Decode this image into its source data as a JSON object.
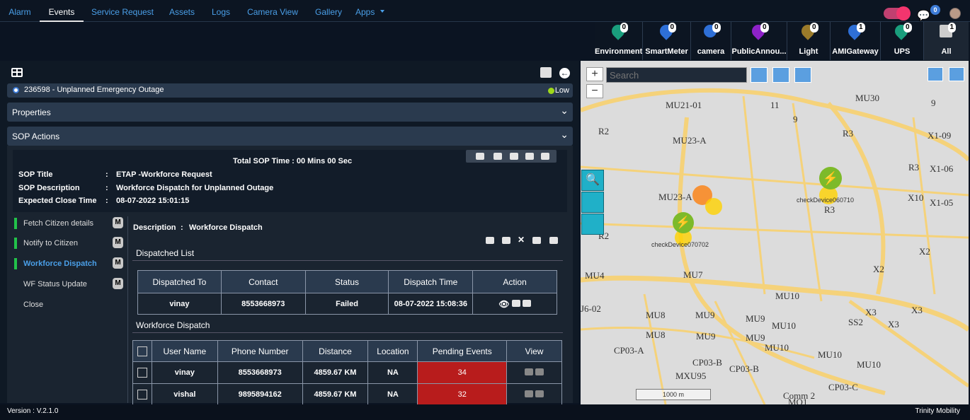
{
  "nav": {
    "tabs": [
      "Alarm",
      "Events",
      "Service Request",
      "Assets",
      "Logs",
      "Camera View",
      "Gallery",
      "Apps"
    ]
  },
  "chat_count": "0",
  "layers": [
    {
      "label": "Environment",
      "count": "0",
      "color": "#1a9e7d"
    },
    {
      "label": "SmartMeter",
      "count": "0",
      "color": "#2e6fd6"
    },
    {
      "label": "camera",
      "count": "0",
      "color": "#2e6fd6"
    },
    {
      "label": "PublicAnnou...",
      "count": "0",
      "color": "#8e22c8"
    },
    {
      "label": "Light",
      "count": "0",
      "color": "#9a7a2a"
    },
    {
      "label": "AMIGateway",
      "count": "1",
      "color": "#2e6fd6"
    },
    {
      "label": "UPS",
      "count": "0",
      "color": "#1a9e7d"
    },
    {
      "label": "All",
      "count": "1",
      "color": "#cccccc"
    }
  ],
  "event": {
    "title": "236598 - Unplanned Emergency Outage",
    "priority": "Low"
  },
  "panels": {
    "properties": "Properties",
    "sop": "SOP Actions"
  },
  "sop": {
    "total_time": "Total SOP Time : 00 Mins 00 Sec",
    "title_label": "SOP Title",
    "title_value": "ETAP -Workforce Request",
    "desc_label": "SOP Description",
    "desc_value": "Workforce Dispatch for Unplanned Outage",
    "close_label": "Expected Close Time",
    "close_value": "08-07-2022 15:01:15",
    "colon": ":"
  },
  "steps": [
    {
      "label": "Fetch Citizen details",
      "m": "M"
    },
    {
      "label": "Notify to Citizen",
      "m": "M"
    },
    {
      "label": "Workforce Dispatch",
      "m": "M"
    },
    {
      "label": "WF Status Update",
      "m": "M"
    },
    {
      "label": "Close",
      "m": ""
    }
  ],
  "description": {
    "label": "Description",
    "colon": ":",
    "value": "Workforce Dispatch"
  },
  "dispatched": {
    "heading": "Dispatched List",
    "headers": [
      "Dispatched To",
      "Contact",
      "Status",
      "Dispatch Time",
      "Action"
    ],
    "rows": [
      [
        "vinay",
        "8553668973",
        "Failed",
        "08-07-2022 15:08:36"
      ]
    ]
  },
  "workforce": {
    "heading": "Workforce Dispatch",
    "headers": [
      "User Name",
      "Phone Number",
      "Distance",
      "Location",
      "Pending Events",
      "View"
    ],
    "rows": [
      [
        "vinay",
        "8553668973",
        "4859.67 KM",
        "NA",
        "34"
      ],
      [
        "vishal",
        "9895894162",
        "4859.67 KM",
        "NA",
        "32"
      ]
    ]
  },
  "map": {
    "search": "Search",
    "scale": "1000 m",
    "labels": [
      "MU21-01",
      "11",
      "MU30",
      "9",
      "MU23-A",
      "R3",
      "R2",
      "X1-09",
      "R3",
      "X1-06",
      "X10",
      "X1-05",
      "MU23-A",
      "R3",
      "X2",
      "X2",
      "MU4",
      "MU7",
      "MU10",
      "J6-02",
      "MU8",
      "MU9",
      "MU9",
      "MU10",
      "X3",
      "X3",
      "MU8",
      "MU9",
      "MU9",
      "SS2",
      "X3",
      "CP03-A",
      "MU10",
      "MU10",
      "CP03-B",
      "CP03-B",
      "CP03-C",
      "MXU95",
      "MU10",
      "Comm 2",
      "MO1",
      "9",
      "R2"
    ],
    "markers": [
      "checkDevice060710",
      "checkDevice070702"
    ],
    "colors": {
      "road": "#f5d27a",
      "land": "#dcdcdc"
    }
  },
  "footer": {
    "version": "Version : V.2.1.0",
    "brand": "Trinity Mobility"
  },
  "colors": {
    "accent": "#4a9fe8",
    "failed_bg": "#b81c1c",
    "green": "#22c24a"
  }
}
